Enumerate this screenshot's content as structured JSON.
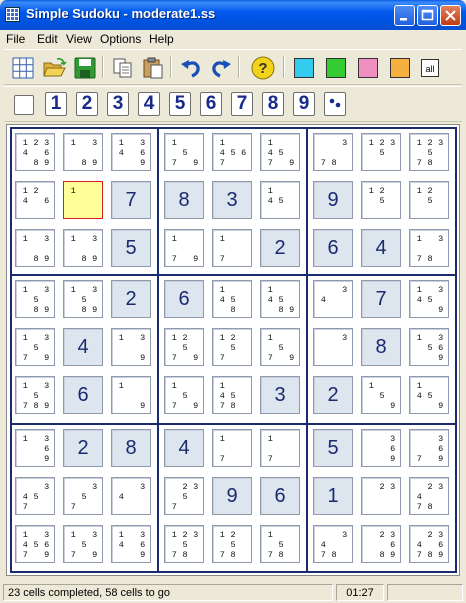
{
  "window": {
    "title": "Simple Sudoku - moderate1.ss"
  },
  "title_buttons": [
    "minimize",
    "maximize",
    "close"
  ],
  "menu": [
    "File",
    "Edit",
    "View",
    "Options",
    "Help"
  ],
  "toolbar1": [
    "new-grid",
    "open",
    "save",
    "copy",
    "paste",
    "undo",
    "redo",
    "hint",
    "color-cyan",
    "color-green",
    "color-pink",
    "color-orange",
    "all"
  ],
  "toolbar1_colors": {
    "cyan": "#33CCEE",
    "green": "#33CC33",
    "pink": "#F090C0",
    "orange": "#F5B040"
  },
  "all_label": "all",
  "toolbar2": {
    "clear": "",
    "numbers": [
      "1",
      "2",
      "3",
      "4",
      "5",
      "6",
      "7",
      "8",
      "9"
    ]
  },
  "grid": [
    [
      {
        "c": "123 46 89"
      },
      {
        "c": "1 3  89"
      },
      {
        "c": "1 346 9"
      },
      {
        "c": "1  5 79"
      },
      {
        "c": "1 456 7"
      },
      {
        "c": "1 45 79"
      },
      {
        "c": "  3  78"
      },
      {
        "c": "123 5"
      },
      {
        "c": "123 5 78"
      }
    ],
    [
      {
        "c": "12 46"
      },
      {
        "c": "1",
        "sel": true
      },
      {
        "v": "7"
      },
      {
        "v": "8"
      },
      {
        "v": "3"
      },
      {
        "c": "1 45"
      },
      {
        "v": "9"
      },
      {
        "c": "12 5"
      },
      {
        "c": "12 5"
      }
    ],
    [
      {
        "c": "1 3  89"
      },
      {
        "c": "1 3  89"
      },
      {
        "v": "5"
      },
      {
        "c": "1  79"
      },
      {
        "c": "1  7"
      },
      {
        "v": "2"
      },
      {
        "v": "6"
      },
      {
        "v": "4"
      },
      {
        "c": "1 3  78"
      }
    ],
    [
      {
        "c": "1 3 5 89"
      },
      {
        "c": "1 3 5 89"
      },
      {
        "v": "2"
      },
      {
        "v": "6"
      },
      {
        "c": "1 45 8"
      },
      {
        "c": "1 45 89"
      },
      {
        "c": "4 3"
      },
      {
        "v": "7"
      },
      {
        "c": "1 3 45 9"
      }
    ],
    [
      {
        "c": "1 3 5 79"
      },
      {
        "v": "4"
      },
      {
        "c": "1 3  9"
      },
      {
        "c": "12 5 79"
      },
      {
        "c": "12 5 7"
      },
      {
        "c": "1  5 79"
      },
      {
        "c": "  3"
      },
      {
        "v": "8"
      },
      {
        "c": "1 3 56 9"
      }
    ],
    [
      {
        "c": "1 3 5 789"
      },
      {
        "v": "6"
      },
      {
        "c": "1  9"
      },
      {
        "c": "1  5 79"
      },
      {
        "c": "1 45 78"
      },
      {
        "v": "3"
      },
      {
        "v": "2"
      },
      {
        "c": "1  5 9"
      },
      {
        "c": "1 45 9"
      }
    ],
    [
      {
        "c": "1 3 6 9"
      },
      {
        "v": "2"
      },
      {
        "v": "8"
      },
      {
        "v": "4"
      },
      {
        "c": "1  7"
      },
      {
        "c": "1  7"
      },
      {
        "v": "5"
      },
      {
        "c": "  3 6 9"
      },
      {
        "c": "  3 6 79"
      }
    ],
    [
      {
        "c": "45 3 7"
      },
      {
        "c": "  3 5 7"
      },
      {
        "c": "4 3"
      },
      {
        "c": " 23 5 7"
      },
      {
        "v": "9"
      },
      {
        "v": "6"
      },
      {
        "v": "1"
      },
      {
        "c": " 23"
      },
      {
        "c": " 234 78"
      }
    ],
    [
      {
        "c": "1 3 456 79"
      },
      {
        "c": "1 3 5 79"
      },
      {
        "c": "1 346 9"
      },
      {
        "c": "123 5 78"
      },
      {
        "c": "12 5 78"
      },
      {
        "c": "1  5 78"
      },
      {
        "c": "4 3 78"
      },
      {
        "c": " 23 6 89"
      },
      {
        "c": " 234 6 789"
      }
    ]
  ],
  "status": {
    "progress": "23 cells completed, 58 cells to go",
    "time": "01:27"
  }
}
